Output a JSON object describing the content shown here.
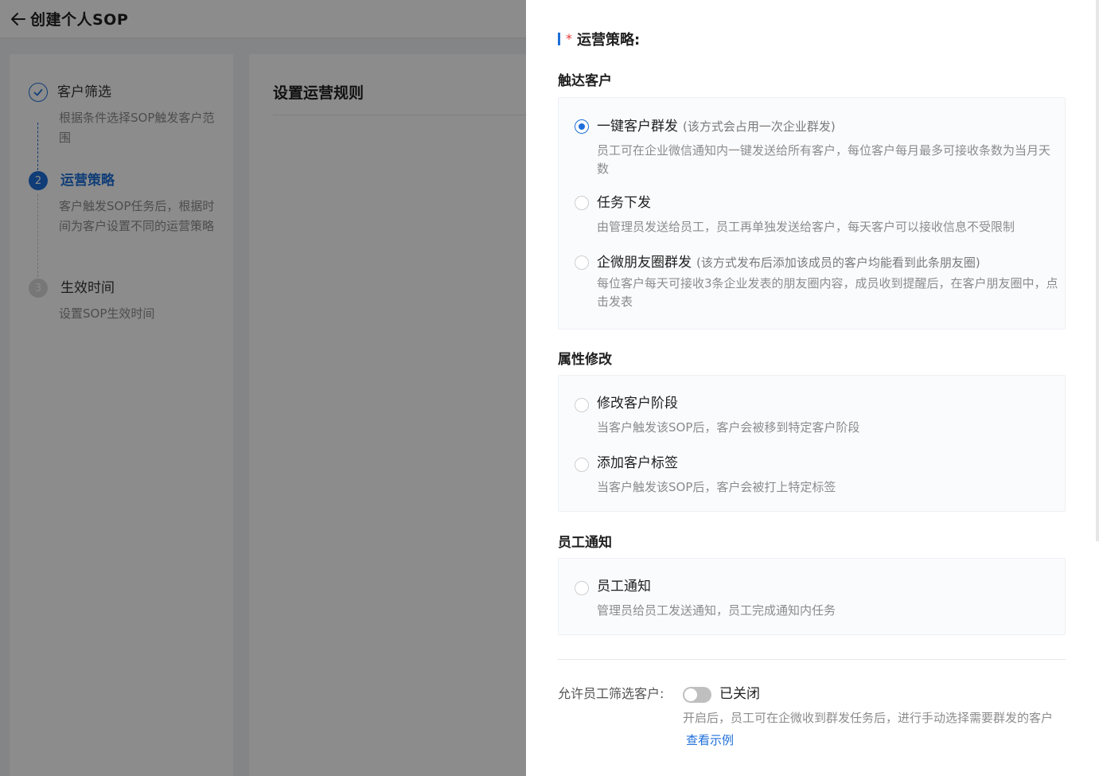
{
  "header": {
    "title": "创建个人SOP"
  },
  "steps": [
    {
      "index": "1",
      "title": "客户筛选",
      "desc": "根据条件选择SOP触发客户范围",
      "state": "done"
    },
    {
      "index": "2",
      "title": "运营策略",
      "desc": "客户触发SOP任务后，根据时间为客户设置不同的运营策略",
      "state": "active"
    },
    {
      "index": "3",
      "title": "生效时间",
      "desc": "设置SOP生效时间",
      "state": "pending"
    }
  ],
  "main": {
    "title": "设置运营规则"
  },
  "drawer": {
    "required_mark": "*",
    "strategy_label": "运营策略:",
    "sections": [
      {
        "title": "触达客户",
        "options": [
          {
            "title": "一键客户群发",
            "note": "(该方式会占用一次企业群发)",
            "desc": "员工可在企业微信通知内一键发送给所有客户，每位客户每月最多可接收条数为当月天数",
            "checked": true
          },
          {
            "title": "任务下发",
            "note": "",
            "desc": "由管理员发送给员工，员工再单独发送给客户，每天客户可以接收信息不受限制",
            "checked": false
          },
          {
            "title": "企微朋友圈群发",
            "note": "(该方式发布后添加该成员的客户均能看到此条朋友圈)",
            "desc": "每位客户每天可接收3条企业发表的朋友圈内容，成员收到提醒后，在客户朋友圈中，点击发表",
            "checked": false
          }
        ]
      },
      {
        "title": "属性修改",
        "options": [
          {
            "title": "修改客户阶段",
            "note": "",
            "desc": "当客户触发该SOP后，客户会被移到特定客户阶段",
            "checked": false
          },
          {
            "title": "添加客户标签",
            "note": "",
            "desc": "当客户触发该SOP后，客户会被打上特定标签",
            "checked": false
          }
        ]
      },
      {
        "title": "员工通知",
        "options": [
          {
            "title": "员工通知",
            "note": "",
            "desc": "管理员给员工发送通知，员工完成通知内任务",
            "checked": false
          }
        ]
      }
    ],
    "allow_filter": {
      "label": "允许员工筛选客户:",
      "switch_on": false,
      "state_text": "已关闭",
      "desc": "开启后，员工可在企微收到群发任务后，进行手动选择需要群发的客户",
      "link": "查看示例"
    }
  },
  "colors": {
    "primary": "#1e6fd9",
    "required": "#e53935",
    "mask": "rgba(0,0,0,0.45)"
  }
}
